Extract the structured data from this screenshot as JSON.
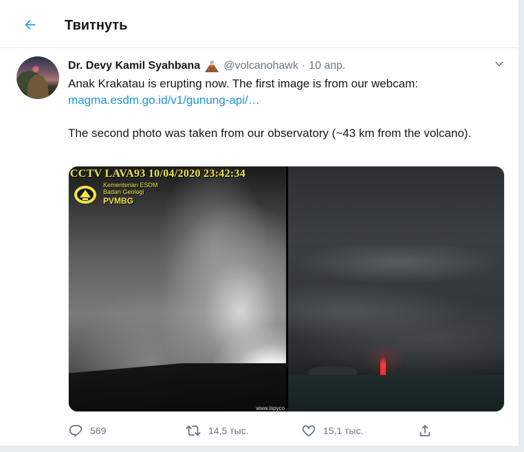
{
  "header": {
    "title": "Твитнуть"
  },
  "tweet": {
    "author_name": "Dr. Devy Kamil Syahbana",
    "author_handle": "@volcanohawk",
    "separator": "·",
    "date": "10 апр.",
    "text_line1": "Anak Krakatau is erupting now. The first image is from our webcam:",
    "link": "magma.esdm.go.id/v1/gunung-api/…",
    "text_line2": "The second photo was taken from our observatory (~43 km from the volcano).",
    "media": {
      "photo1_overlay": "CCTV LAVA93 10/04/2020 23:42:34",
      "photo1_agency_line1": "Kementerian ESDM",
      "photo1_agency_line2": "Badan Geologi",
      "photo1_agency_line3": "PVMBG",
      "photo1_watermark": "www.ispyco"
    },
    "actions": {
      "reply_count": "569",
      "retweet_count": "14,5 тыс.",
      "like_count": "15,1 тыс."
    }
  },
  "colors": {
    "accent": "#1da1f2",
    "link": "#1b95e0",
    "secondary_text": "#657786"
  }
}
